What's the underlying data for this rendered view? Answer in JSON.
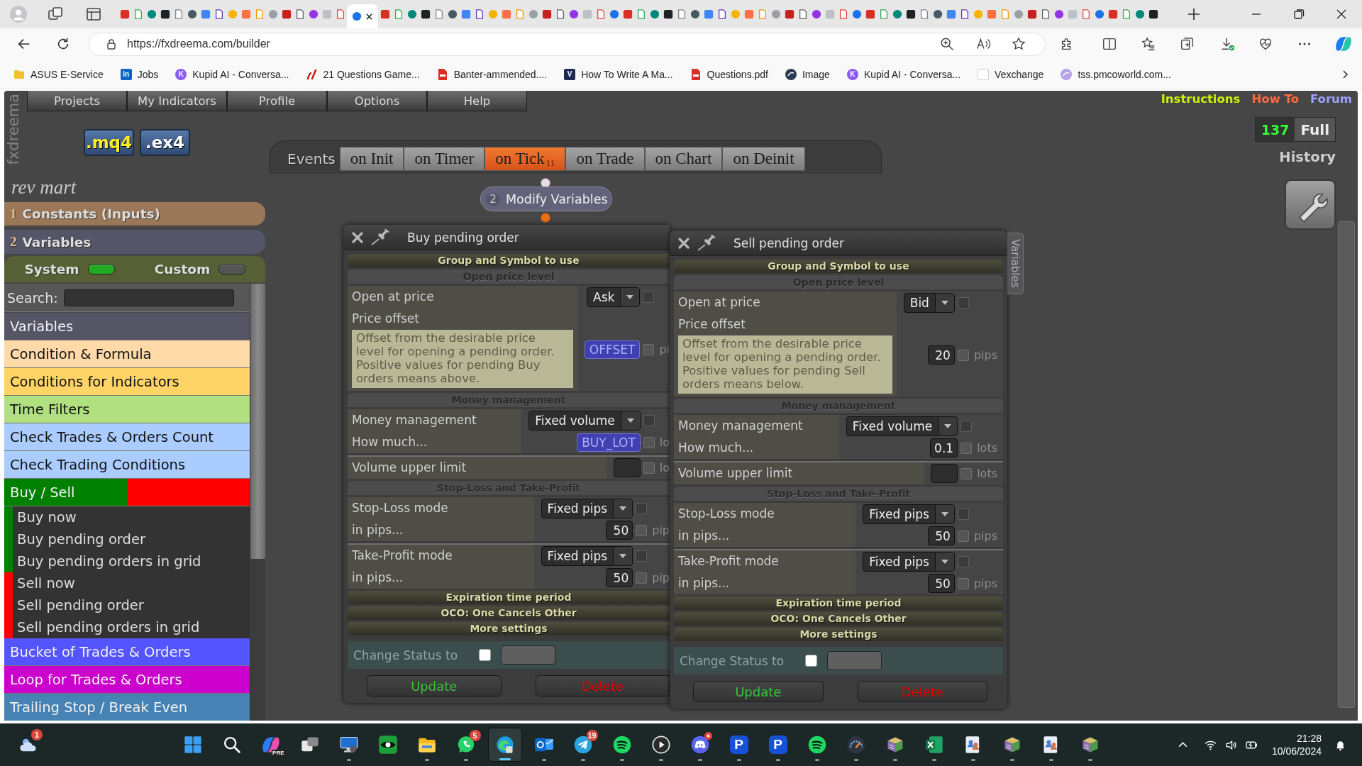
{
  "browser": {
    "tabs": [
      {
        "selected": false
      },
      {
        "selected": false
      },
      {
        "selected": false
      },
      {
        "selected": false
      },
      {
        "selected": false
      },
      {
        "selected": false
      },
      {
        "selected": false
      },
      {
        "selected": false
      },
      {
        "selected": false
      },
      {
        "selected": false
      },
      {
        "selected": false
      },
      {
        "selected": false
      },
      {
        "selected": false
      },
      {
        "selected": false
      },
      {
        "selected": false
      },
      {
        "selected": false
      },
      {
        "selected": false
      },
      {
        "selected": true
      },
      {
        "selected": false
      },
      {
        "selected": false
      },
      {
        "selected": false
      },
      {
        "selected": false
      },
      {
        "selected": false
      },
      {
        "selected": false
      },
      {
        "selected": false
      },
      {
        "selected": false
      },
      {
        "selected": false
      },
      {
        "selected": false
      },
      {
        "selected": false
      },
      {
        "selected": false
      },
      {
        "selected": false
      },
      {
        "selected": false
      },
      {
        "selected": false
      },
      {
        "selected": false
      },
      {
        "selected": false
      },
      {
        "selected": false
      },
      {
        "selected": false
      },
      {
        "selected": false
      },
      {
        "selected": false
      },
      {
        "selected": false
      },
      {
        "selected": false
      },
      {
        "selected": false
      },
      {
        "selected": false
      },
      {
        "selected": false
      },
      {
        "selected": false
      },
      {
        "selected": false
      },
      {
        "selected": false
      },
      {
        "selected": false
      },
      {
        "selected": false
      },
      {
        "selected": false
      },
      {
        "selected": false
      },
      {
        "selected": false
      },
      {
        "selected": false
      },
      {
        "selected": false
      },
      {
        "selected": false
      },
      {
        "selected": false
      },
      {
        "selected": false
      },
      {
        "selected": false
      },
      {
        "selected": false
      },
      {
        "selected": false
      },
      {
        "selected": false
      },
      {
        "selected": false
      },
      {
        "selected": false
      },
      {
        "selected": false
      },
      {
        "selected": false
      },
      {
        "selected": false
      },
      {
        "selected": false
      },
      {
        "selected": false
      },
      {
        "selected": false
      },
      {
        "selected": false
      },
      {
        "selected": false
      },
      {
        "selected": false
      },
      {
        "selected": false
      },
      {
        "selected": false
      },
      {
        "selected": false
      },
      {
        "selected": false
      }
    ],
    "url": "https://fxdreema.com/builder",
    "bookmarks": [
      {
        "label": "ASUS E-Service",
        "kind": "folder",
        "color": "#f2c12e"
      },
      {
        "label": "Jobs",
        "kind": "tile",
        "glyph": "in",
        "color": "#0a66c2"
      },
      {
        "label": "Kupid AI - Conversa...",
        "kind": "disc",
        "glyph": "K",
        "color": "#8a5cf6"
      },
      {
        "label": "21 Questions Game...",
        "kind": "mark",
        "color": "#cc1111"
      },
      {
        "label": "Banter-ammended....",
        "kind": "document",
        "color": "#d93025"
      },
      {
        "label": "How To Write A Ma...",
        "kind": "tile",
        "glyph": "V",
        "color": "#1d2b53"
      },
      {
        "label": "Questions.pdf",
        "kind": "document",
        "color": "#d93025"
      },
      {
        "label": "Image",
        "kind": "disc",
        "color": "#2b3a55"
      },
      {
        "label": "Kupid AI - Conversa...",
        "kind": "disc",
        "glyph": "K",
        "color": "#8a5cf6"
      },
      {
        "label": "Vexchange",
        "kind": "blank"
      },
      {
        "label": "tss.pmcoworld.com...",
        "kind": "disc",
        "color": "#b9a3e8"
      }
    ]
  },
  "app": {
    "logo": "fxdreema",
    "menu": [
      "Projects",
      "My Indicators",
      "Profile",
      "Options",
      "Help"
    ],
    "links": [
      {
        "label": "Instructions",
        "color": "#ccf000"
      },
      {
        "label": "How To",
        "color": "#ff6a3d"
      },
      {
        "label": "Forum",
        "color": "#a0a0ff"
      }
    ],
    "exports": [
      {
        "label": ".mq4",
        "kind": "source"
      },
      {
        "label": ".ex4",
        "kind": "compiled"
      }
    ],
    "counter": {
      "value": "137",
      "label": "Full"
    },
    "history": "History",
    "events": {
      "label": "Events",
      "tabs": [
        {
          "label": "on Init",
          "selected": false
        },
        {
          "label": "on Timer",
          "selected": false
        },
        {
          "label": "on Tick",
          "count": "11",
          "selected": true
        },
        {
          "label": "on Trade",
          "selected": false
        },
        {
          "label": "on Chart",
          "selected": false
        },
        {
          "label": "on Deinit",
          "selected": false
        }
      ]
    },
    "node": {
      "number": "2",
      "title": "Modify Variables"
    },
    "dialogs": [
      {
        "title": "Buy pending order",
        "sections": [
          {
            "title": "Group and Symbol to use",
            "kind": "collapsed"
          },
          {
            "title": "Open price level",
            "kind": "open",
            "groups": [
              [
                {
                  "label": "Open at price",
                  "kind": "select",
                  "value": "Ask",
                  "checkbox": {
                    "checked": false,
                    "disabled": true
                  }
                },
                {
                  "label": "Price offset",
                  "description": "Offset from the desirable price\nlevel for opening a pending order.\nPositive values for pending Buy\norders means above.",
                  "kind": "variable",
                  "value": "OFFSET",
                  "checkbox": {
                    "checked": false,
                    "disabled": false
                  },
                  "unit": "pi"
                }
              ]
            ]
          },
          {
            "title": "Money management",
            "kind": "open",
            "groups": [
              [
                {
                  "label": "Money management",
                  "kind": "select",
                  "value": "Fixed volume",
                  "checkbox": {
                    "checked": false,
                    "disabled": true
                  }
                },
                {
                  "label": "How much...",
                  "kind": "variable",
                  "value": "BUY_LOT",
                  "checkbox": {
                    "checked": false,
                    "disabled": false
                  },
                  "unit": "lo"
                }
              ],
              [
                {
                  "label": "Volume upper limit",
                  "kind": "input",
                  "checkbox": {
                    "checked": false,
                    "disabled": false
                  },
                  "unit": "lo"
                }
              ]
            ]
          },
          {
            "title": "Stop-Loss and Take-Profit",
            "kind": "open",
            "groups": [
              [
                {
                  "label": "Stop-Loss mode",
                  "kind": "select",
                  "value": "Fixed pips",
                  "checkbox": {
                    "checked": false,
                    "disabled": true
                  }
                },
                {
                  "label": "in pips...",
                  "kind": "input",
                  "value": "50",
                  "checkbox": {
                    "checked": false,
                    "disabled": false
                  },
                  "unit": "pip"
                }
              ],
              [
                {
                  "label": "Take-Profit mode",
                  "kind": "select",
                  "value": "Fixed pips",
                  "checkbox": {
                    "checked": false,
                    "disabled": true
                  }
                },
                {
                  "label": "in pips...",
                  "kind": "input",
                  "value": "50",
                  "checkbox": {
                    "checked": false,
                    "disabled": false
                  },
                  "unit": "pip"
                }
              ]
            ]
          },
          {
            "title": "Expiration time period",
            "kind": "collapsed"
          },
          {
            "title": "OCO: One Cancels Other",
            "kind": "collapsed"
          },
          {
            "title": "More settings",
            "kind": "collapsed"
          }
        ],
        "status": {
          "label": "Change Status to",
          "checked": false
        },
        "buttons": [
          {
            "label": "Update",
            "kind": "update"
          },
          {
            "label": "Delete",
            "kind": "delete"
          }
        ]
      },
      {
        "title": "Sell pending order",
        "side_tab": "Variables",
        "sections": [
          {
            "title": "Group and Symbol to use",
            "kind": "collapsed"
          },
          {
            "title": "Open price level",
            "kind": "open",
            "groups": [
              [
                {
                  "label": "Open at price",
                  "kind": "select",
                  "value": "Bid",
                  "checkbox": {
                    "checked": false,
                    "disabled": true
                  }
                },
                {
                  "label": "Price offset",
                  "description": "Offset from the desirable price\nlevel for opening a pending order.\nPositive values for pending Sell\norders means below.",
                  "kind": "input",
                  "value": "20",
                  "checkbox": {
                    "checked": false,
                    "disabled": false
                  },
                  "unit": "pips"
                }
              ]
            ]
          },
          {
            "title": "Money management",
            "kind": "open",
            "groups": [
              [
                {
                  "label": "Money management",
                  "kind": "select",
                  "value": "Fixed volume",
                  "checkbox": {
                    "checked": false,
                    "disabled": true
                  }
                },
                {
                  "label": "How much...",
                  "kind": "input",
                  "value": "0.1",
                  "checkbox": {
                    "checked": false,
                    "disabled": false
                  },
                  "unit": "lots"
                }
              ],
              [
                {
                  "label": "Volume upper limit",
                  "kind": "input",
                  "checkbox": {
                    "checked": false,
                    "disabled": false
                  },
                  "unit": "lots"
                }
              ]
            ]
          },
          {
            "title": "Stop-Loss and Take-Profit",
            "kind": "open",
            "groups": [
              [
                {
                  "label": "Stop-Loss mode",
                  "kind": "select",
                  "value": "Fixed pips",
                  "checkbox": {
                    "checked": false,
                    "disabled": true
                  }
                },
                {
                  "label": "in pips...",
                  "kind": "input",
                  "value": "50",
                  "checkbox": {
                    "checked": false,
                    "disabled": false
                  },
                  "unit": "pips"
                }
              ],
              [
                {
                  "label": "Take-Profit mode",
                  "kind": "select",
                  "value": "Fixed pips",
                  "checkbox": {
                    "checked": false,
                    "disabled": true
                  }
                },
                {
                  "label": "in pips...",
                  "kind": "input",
                  "value": "50",
                  "checkbox": {
                    "checked": false,
                    "disabled": false
                  },
                  "unit": "pips"
                }
              ]
            ]
          },
          {
            "title": "Expiration time period",
            "kind": "collapsed"
          },
          {
            "title": "OCO: One Cancels Other",
            "kind": "collapsed"
          },
          {
            "title": "More settings",
            "kind": "collapsed"
          }
        ],
        "status": {
          "label": "Change Status to",
          "checked": false
        },
        "buttons": [
          {
            "label": "Update",
            "kind": "update"
          },
          {
            "label": "Delete",
            "kind": "delete"
          }
        ]
      }
    ]
  },
  "sidebar": {
    "project": "rev mart",
    "sections": [
      {
        "number": "1",
        "title": "Constants (Inputs)",
        "color": "#9a7756"
      },
      {
        "number": "2",
        "title": "Variables",
        "color": "#555568"
      }
    ],
    "toggles": [
      {
        "label": "System",
        "on": true
      },
      {
        "label": "Custom",
        "on": false
      }
    ],
    "search": {
      "label": "Search:"
    },
    "categories": [
      {
        "label": "Variables",
        "color": "#555566"
      },
      {
        "label": "Condition & Formula",
        "color": "#ffd9a8"
      },
      {
        "label": "Conditions for Indicators",
        "color": "#ffd466"
      },
      {
        "label": "Time Filters",
        "color": "#b0e080"
      },
      {
        "label": "Check Trades & Orders Count",
        "color": "#aaccff"
      },
      {
        "label": "Check Trading Conditions",
        "color": "#aaccff"
      },
      {
        "label": "Buy / Sell",
        "color": "#008000",
        "band": {
          "color": "#ff0000"
        },
        "children": [
          {
            "label": "Buy now",
            "color": "#008000"
          },
          {
            "label": "Buy pending order",
            "color": "#008000"
          },
          {
            "label": "Buy pending orders in grid",
            "color": "#008000"
          },
          {
            "label": "Sell now",
            "color": "#ff0000"
          },
          {
            "label": "Sell pending order",
            "color": "#ff0000"
          },
          {
            "label": "Sell pending orders in grid",
            "color": "#ff0000"
          }
        ]
      },
      {
        "label": "Bucket of Trades & Orders",
        "color": "#5555ff"
      },
      {
        "label": "Loop for Trades & Orders",
        "color": "#cc00cc"
      },
      {
        "label": "Trailing Stop / Break Even",
        "color": "#4682b4"
      }
    ]
  },
  "taskbar": {
    "widgets_badge": "1",
    "apps": [
      {
        "kind": "windows",
        "running": false,
        "selected": false
      },
      {
        "kind": "search",
        "running": false,
        "selected": false
      },
      {
        "kind": "copilot",
        "label": "PRE",
        "running": false,
        "selected": false
      },
      {
        "kind": "taskview",
        "running": false,
        "selected": false
      },
      {
        "kind": "monitor",
        "running": true,
        "selected": false
      },
      {
        "kind": "eye",
        "running": false,
        "selected": false
      },
      {
        "kind": "folder",
        "running": true,
        "selected": false
      },
      {
        "kind": "chat",
        "badge": "5",
        "running": true,
        "selected": false
      },
      {
        "kind": "browser",
        "running": true,
        "selected": true
      },
      {
        "kind": "mail",
        "running": true,
        "selected": false
      },
      {
        "kind": "plane",
        "badge": "19",
        "running": true,
        "selected": false
      },
      {
        "kind": "music",
        "running": true,
        "selected": false
      },
      {
        "kind": "play",
        "running": true,
        "selected": false
      },
      {
        "kind": "gamepad",
        "dot": true,
        "running": true,
        "selected": false
      },
      {
        "kind": "letter",
        "glyph": "P",
        "running": true,
        "selected": false
      },
      {
        "kind": "letter",
        "glyph": "P",
        "running": true,
        "selected": false
      },
      {
        "kind": "music",
        "running": true,
        "selected": false
      },
      {
        "kind": "gauge",
        "running": true,
        "selected": false
      },
      {
        "kind": "books",
        "running": true,
        "selected": false
      },
      {
        "kind": "sheet",
        "running": true,
        "selected": false
      },
      {
        "kind": "people",
        "running": true,
        "selected": false
      },
      {
        "kind": "books",
        "running": true,
        "selected": false
      },
      {
        "kind": "people",
        "running": true,
        "selected": false
      },
      {
        "kind": "books",
        "running": true,
        "selected": false
      }
    ],
    "time": "21:28",
    "date": "10/06/2024"
  }
}
